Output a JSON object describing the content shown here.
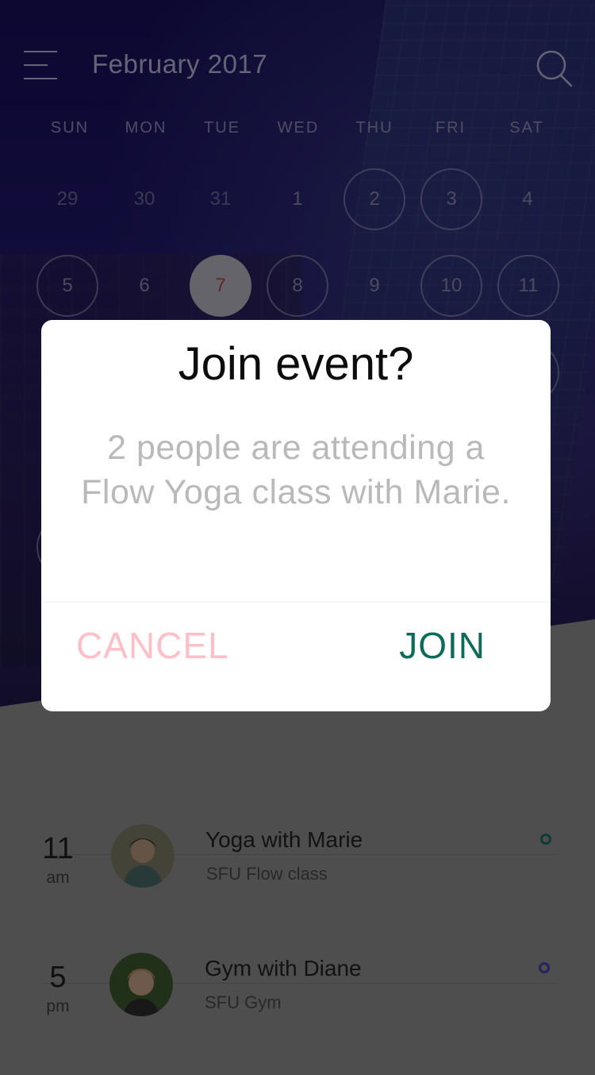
{
  "header": {
    "month_title": "February 2017",
    "menu_icon": "hamburger-menu-icon",
    "search_icon": "search-icon"
  },
  "calendar": {
    "weekdays": [
      "SUN",
      "MON",
      "TUE",
      "WED",
      "THU",
      "FRI",
      "SAT"
    ],
    "week1": [
      "29",
      "30",
      "31",
      "1",
      "2",
      "3",
      "4"
    ],
    "week2": [
      "5",
      "6",
      "7",
      "8",
      "9",
      "10",
      "11"
    ],
    "selected_day": "7"
  },
  "events": [
    {
      "hour": "11",
      "ampm": "am",
      "title": "Yoga with Marie",
      "subtitle": "SFU Flow class",
      "status_color": "#1f8a78"
    },
    {
      "hour": "5",
      "ampm": "pm",
      "title": "Gym with Diane",
      "subtitle": "SFU Gym",
      "status_color": "#5b4fc9"
    }
  ],
  "dialog": {
    "title": "Join event?",
    "message": "2 people are attending a Flow Yoga class with Marie.",
    "cancel_label": "CANCEL",
    "join_label": "JOIN"
  },
  "colors": {
    "accent_cancel": "#ffbfc8",
    "accent_join": "#0f6b59",
    "today_text": "#b3484f"
  }
}
